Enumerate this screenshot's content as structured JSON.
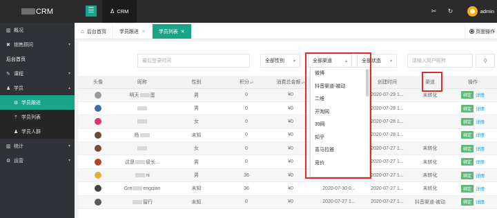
{
  "app": {
    "logo_text": "CRM",
    "module_tab": "CRM",
    "user": "admin"
  },
  "sidebar": [
    {
      "icon": "chart",
      "label": "概况",
      "type": "top"
    },
    {
      "icon": "x",
      "label": "销售顾问",
      "type": "top",
      "arrow": "▾"
    },
    {
      "icon": "",
      "label": "后台首页",
      "type": "plain"
    },
    {
      "icon": "edit",
      "label": "课程",
      "type": "top",
      "arrow": "▾"
    },
    {
      "icon": "users",
      "label": "学员",
      "type": "top",
      "arrow": "▴"
    },
    {
      "icon": "gear",
      "label": "学员跟进",
      "type": "sub-active"
    },
    {
      "icon": "up",
      "label": "学员列表",
      "type": "sub"
    },
    {
      "icon": "users",
      "label": "学员人群",
      "type": "sub"
    },
    {
      "icon": "chart",
      "label": "统计",
      "type": "top",
      "arrow": "▾"
    },
    {
      "icon": "gear",
      "label": "运营",
      "type": "top",
      "arrow": "▾"
    }
  ],
  "tabs": [
    {
      "label": "后台首页",
      "home": true
    },
    {
      "label": "学员跟进",
      "close": true
    },
    {
      "label": "学员列表",
      "close": true,
      "active": true
    }
  ],
  "page_op": "页面操作",
  "filters": {
    "login_time_placeholder": "最后登录时间",
    "gender": "全部性别",
    "channel": "全部渠道",
    "status": "全部状态",
    "search_placeholder": "请输入用户昵称"
  },
  "columns": [
    "头像",
    "昵称",
    "性别",
    "积分",
    "消费总金额",
    "",
    "创建时间",
    "渠道",
    "操作"
  ],
  "rows": [
    {
      "nick": "明天",
      "nick2": "蛋",
      "gender": "男",
      "points": "0",
      "amount": "¥0",
      "c5": "",
      "created": "2020-07-29 1...",
      "channel": "未转化",
      "avatar": "#9a9a9a"
    },
    {
      "nick": "",
      "nick2": "",
      "gender": "男",
      "points": "0",
      "amount": "¥0",
      "c5": "",
      "created": "2020-07-28 1...",
      "channel": "",
      "avatar": "#3b6ea8"
    },
    {
      "nick": "",
      "nick2": "",
      "gender": "女",
      "points": "0",
      "amount": "¥0",
      "c5": "",
      "created": "2020-07-28 1...",
      "channel": "",
      "avatar": "#d8356d"
    },
    {
      "nick": "杨",
      "nick2": "",
      "gender": "未知",
      "points": "0",
      "amount": "¥0",
      "c5": "",
      "created": "2020-07-28 1...",
      "channel": "",
      "avatar": "#6b4a33"
    },
    {
      "nick": "",
      "nick2": "",
      "gender": "女",
      "points": "0",
      "amount": "¥0",
      "c5": "",
      "created": "2020-07-27 1...",
      "channel": "未转化",
      "avatar": "#7a4b30"
    },
    {
      "nick": "这是",
      "nick2": "级长...",
      "gender": "男",
      "points": "0",
      "amount": "¥0",
      "c5": "",
      "created": "2020-07-27 1...",
      "channel": "未转化",
      "avatar": "#b3452a"
    },
    {
      "nick": "",
      "nick2": "ni",
      "gender": "男",
      "points": "36",
      "amount": "¥0",
      "c5": "2020-07-27 1...",
      "created": "2020-07-27 1...",
      "channel": "未转化",
      "avatar": "#e0b030"
    },
    {
      "nick": "Gre",
      "nick2": "engqian",
      "gender": "未知",
      "points": "36",
      "amount": "¥0",
      "c5": "2020-07-30 0...",
      "created": "2020-07-27 1...",
      "channel": "未转化",
      "avatar": "#444444"
    },
    {
      "nick": "",
      "nick2": "留行",
      "gender": "未知",
      "points": "0",
      "amount": "¥0",
      "c5": "2020-07-27 1...",
      "created": "2020-07-27 1...",
      "channel": "抖音渠道-被动",
      "avatar": "#5a5a5a"
    }
  ],
  "row_actions": {
    "bind": "绑定",
    "detail": "详情"
  },
  "channel_options": [
    "微博",
    "抖音渠道-被动",
    "二维",
    "开淘网",
    "39网",
    "知乎",
    "喜马拉雅",
    "竞价"
  ]
}
